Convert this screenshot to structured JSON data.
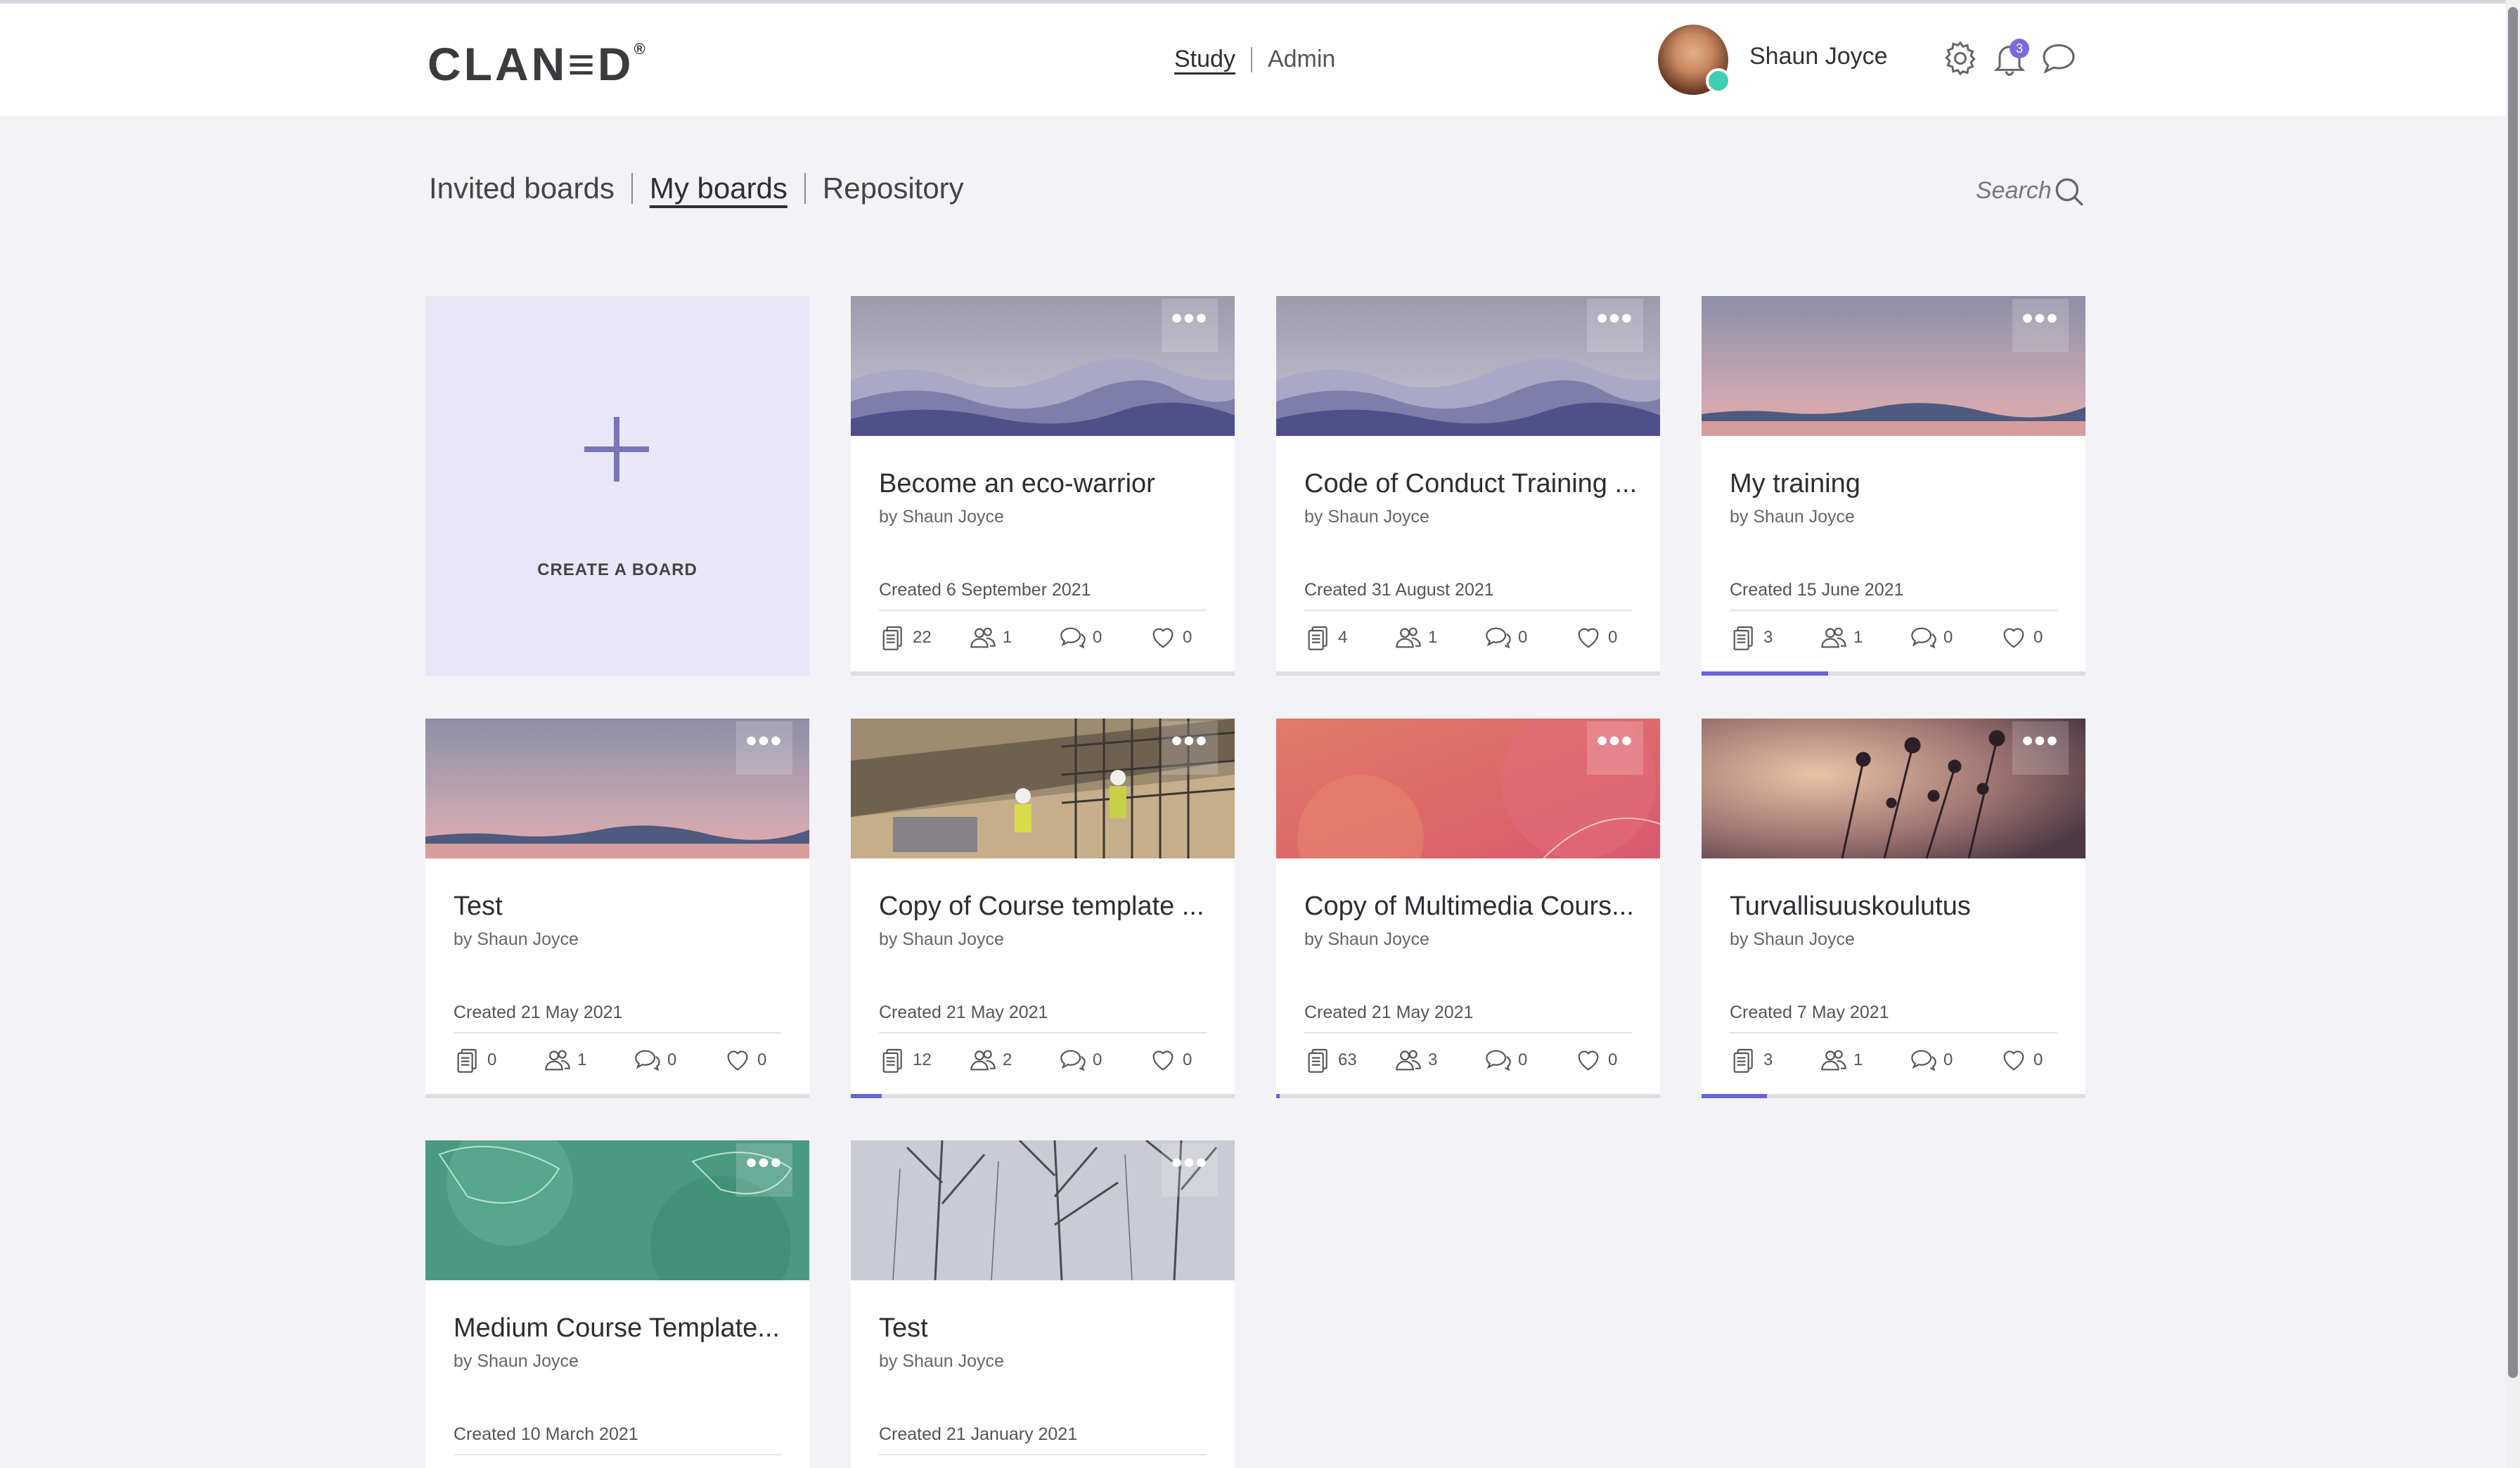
{
  "app": {
    "logo": "CLAN≡D",
    "logo_mark": "®"
  },
  "topnav": {
    "study": "Study",
    "admin": "Admin"
  },
  "user": {
    "name": "Shaun Joyce",
    "notification_count": "3"
  },
  "tabs": {
    "invited": "Invited boards",
    "my": "My boards",
    "repository": "Repository"
  },
  "search": {
    "placeholder": "Search"
  },
  "create_board": {
    "label": "CREATE A BOARD"
  },
  "boards": [
    {
      "title": "Become an eco-warrior",
      "author": "by Shaun Joyce",
      "created": "Created 6 September 2021",
      "files": "22",
      "members": "1",
      "comments": "0",
      "likes": "0",
      "progress": 0,
      "image": "mountains"
    },
    {
      "title": "Code of Conduct Training ...",
      "author": "by Shaun Joyce",
      "created": "Created 31 August 2021",
      "files": "4",
      "members": "1",
      "comments": "0",
      "likes": "0",
      "progress": 0,
      "image": "mountains"
    },
    {
      "title": "My training",
      "author": "by Shaun Joyce",
      "created": "Created 15 June 2021",
      "files": "3",
      "members": "1",
      "comments": "0",
      "likes": "0",
      "progress": 0.33,
      "image": "sunset"
    },
    {
      "title": "Test",
      "author": "by Shaun Joyce",
      "created": "Created 21 May 2021",
      "files": "0",
      "members": "1",
      "comments": "0",
      "likes": "0",
      "progress": 0,
      "image": "sunset"
    },
    {
      "title": "Copy of Course template ...",
      "author": "by Shaun Joyce",
      "created": "Created 21 May 2021",
      "files": "12",
      "members": "2",
      "comments": "0",
      "likes": "0",
      "progress": 0.08,
      "image": "construction"
    },
    {
      "title": "Copy of Multimedia Cours...",
      "author": "by Shaun Joyce",
      "created": "Created 21 May 2021",
      "files": "63",
      "members": "3",
      "comments": "0",
      "likes": "0",
      "progress": 0.01,
      "image": "coral"
    },
    {
      "title": "Turvallisuuskoulutus",
      "author": "by Shaun Joyce",
      "created": "Created 7 May 2021",
      "files": "3",
      "members": "1",
      "comments": "0",
      "likes": "0",
      "progress": 0.17,
      "image": "flowers"
    },
    {
      "title": "Medium Course Template...",
      "author": "by Shaun Joyce",
      "created": "Created 10 March 2021",
      "image": "green"
    },
    {
      "title": "Test",
      "author": "by Shaun Joyce",
      "created": "Created 21 January 2021",
      "image": "trees"
    }
  ],
  "colors": {
    "accent": "#6a62d8",
    "create_bg": "#e9e7f7",
    "online": "#3ecfb2",
    "badge": "#7a6cdb"
  }
}
